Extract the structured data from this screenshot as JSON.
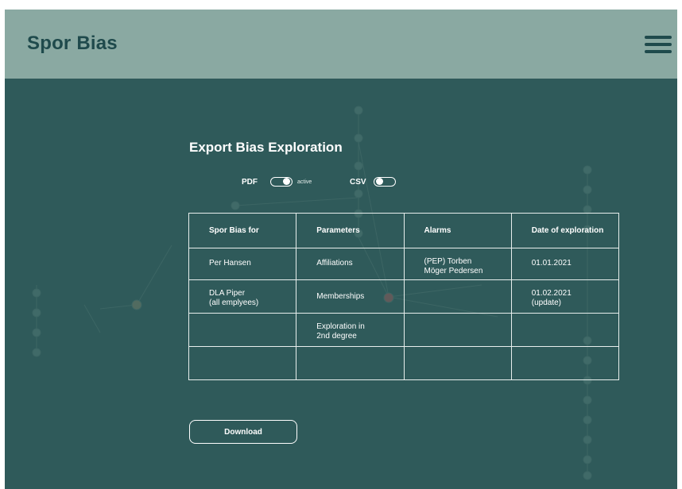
{
  "header": {
    "brand": "Spor Bias"
  },
  "export": {
    "title": "Export Bias Exploration",
    "formats": [
      {
        "label": "PDF",
        "state_label": "active",
        "on": true
      },
      {
        "label": "CSV",
        "state_label": "",
        "on": false
      }
    ],
    "table": {
      "columns": [
        "Spor Bias for",
        "Parameters",
        "Alarms",
        "Date of exploration"
      ],
      "rows": [
        {
          "spor_bias_for": [
            "Per Hansen"
          ],
          "parameters": [
            "Affiliations"
          ],
          "alarms": [
            "(PEP) Torben",
            "Möger Pedersen"
          ],
          "date": [
            "01.01.2021"
          ]
        },
        {
          "spor_bias_for": [
            "DLA Piper",
            "(all emplyees)"
          ],
          "parameters": [
            "Memberships"
          ],
          "alarms": [],
          "date": [
            "01.02.2021",
            "(update)"
          ]
        },
        {
          "spor_bias_for": [],
          "parameters": [
            "Exploration in",
            "2nd degree"
          ],
          "alarms": [],
          "date": []
        },
        {
          "spor_bias_for": [],
          "parameters": [],
          "alarms": [],
          "date": []
        }
      ]
    },
    "download_label": "Download"
  },
  "colors": {
    "header_bg": "#8aa9a2",
    "page_bg": "#2f5a5a",
    "brand_text": "#1f4a4c",
    "text": "#ffffff"
  },
  "icons": {
    "menu": "hamburger-menu-icon"
  }
}
